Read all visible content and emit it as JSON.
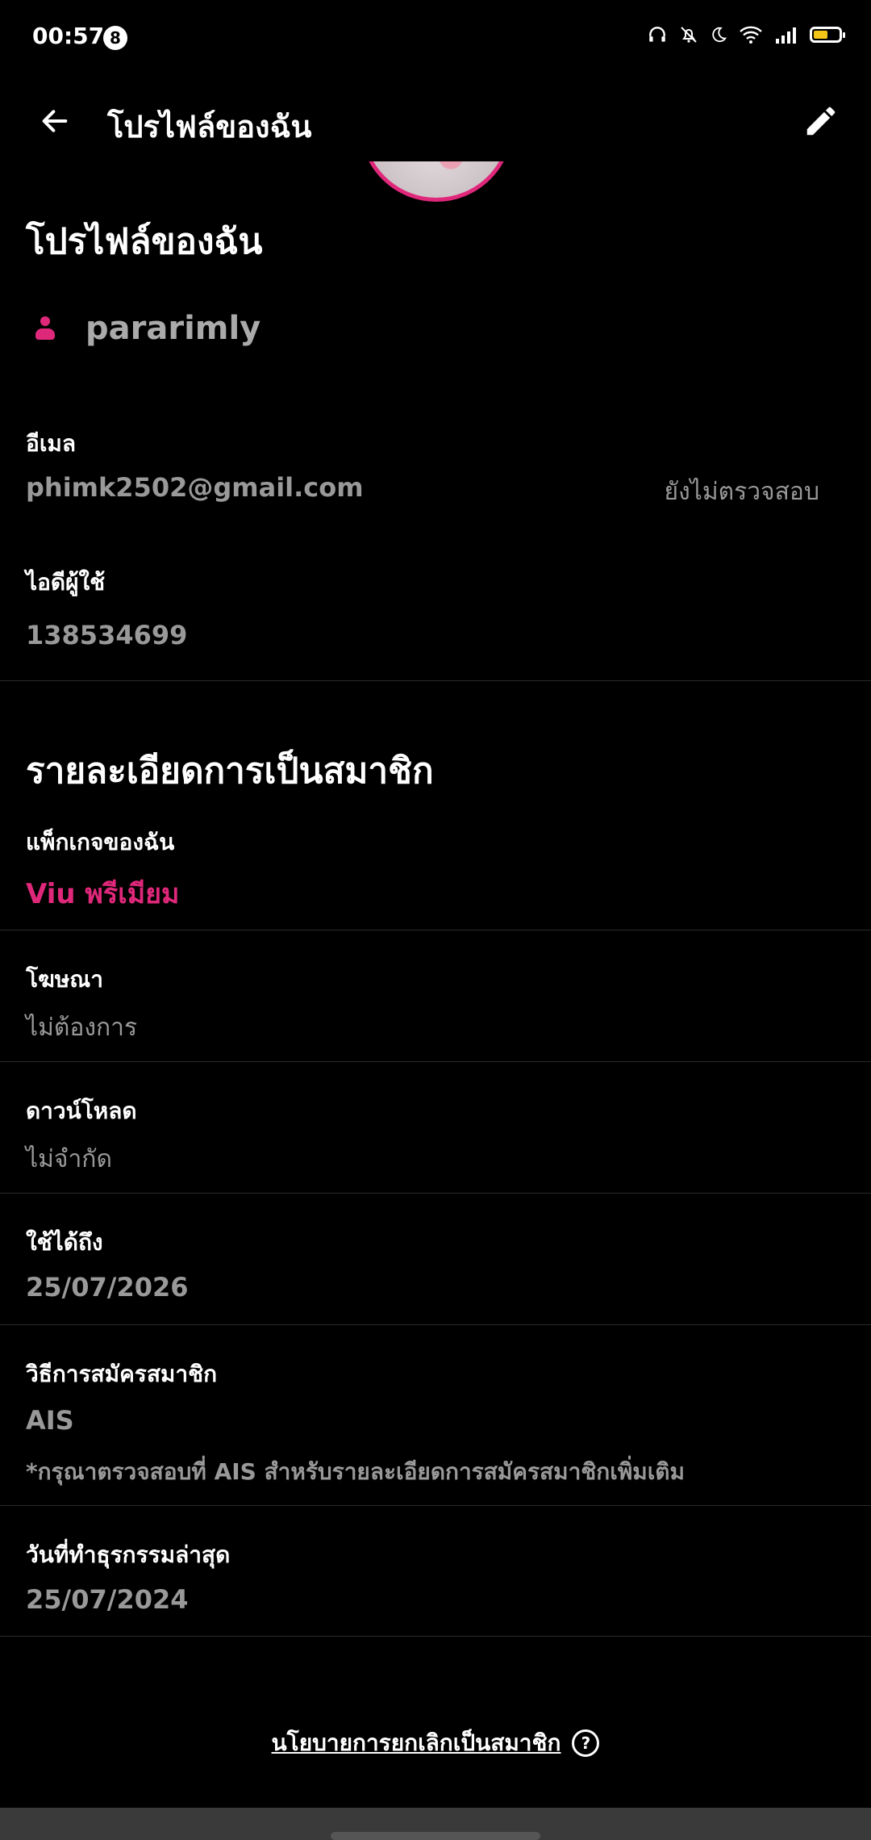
{
  "status_bar": {
    "time": "00:57",
    "notification_count": "8",
    "battery_level": 0.55,
    "battery_color": "#f5c518"
  },
  "header": {
    "title": "โปรไฟล์ของฉัน",
    "back_icon": "arrow-left-icon",
    "edit_icon": "pencil-icon"
  },
  "profile": {
    "section_title": "โปรไฟล์ของฉัน",
    "username": "pararimly",
    "email_label": "อีเมล",
    "email": "phimk2502@gmail.com",
    "email_status": "ยังไม่ตรวจสอบ",
    "user_id_label": "ไอดีผู้ใช้",
    "user_id": "138534699"
  },
  "membership": {
    "section_title": "รายละเอียดการเป็นสมาชิก",
    "package_label": "แพ็กเกจของฉัน",
    "package": "Viu พรีเมียม",
    "ads_label": "โฆษณา",
    "ads_value": "ไม่ต้องการ",
    "download_label": "ดาวน์โหลด",
    "download_value": "ไม่จำกัด",
    "valid_until_label": "ใช้ได้ถึง",
    "valid_until": "25/07/2026",
    "method_label": "วิธีการสมัครสมาชิก",
    "method": "AIS",
    "method_note": "*กรุณาตรวจสอบที่ AIS สำหรับรายละเอียดการสมัครสมาชิกเพิ่มเติม",
    "last_txn_label": "วันที่ทำธุรกรรมล่าสุด",
    "last_txn": "25/07/2024"
  },
  "footer": {
    "cancel_policy_link": "นโยบายการยกเลิกเป็นสมาชิก",
    "help_glyph": "?"
  },
  "colors": {
    "accent": "#e0287b",
    "background": "#000000",
    "muted_text": "#999999"
  }
}
